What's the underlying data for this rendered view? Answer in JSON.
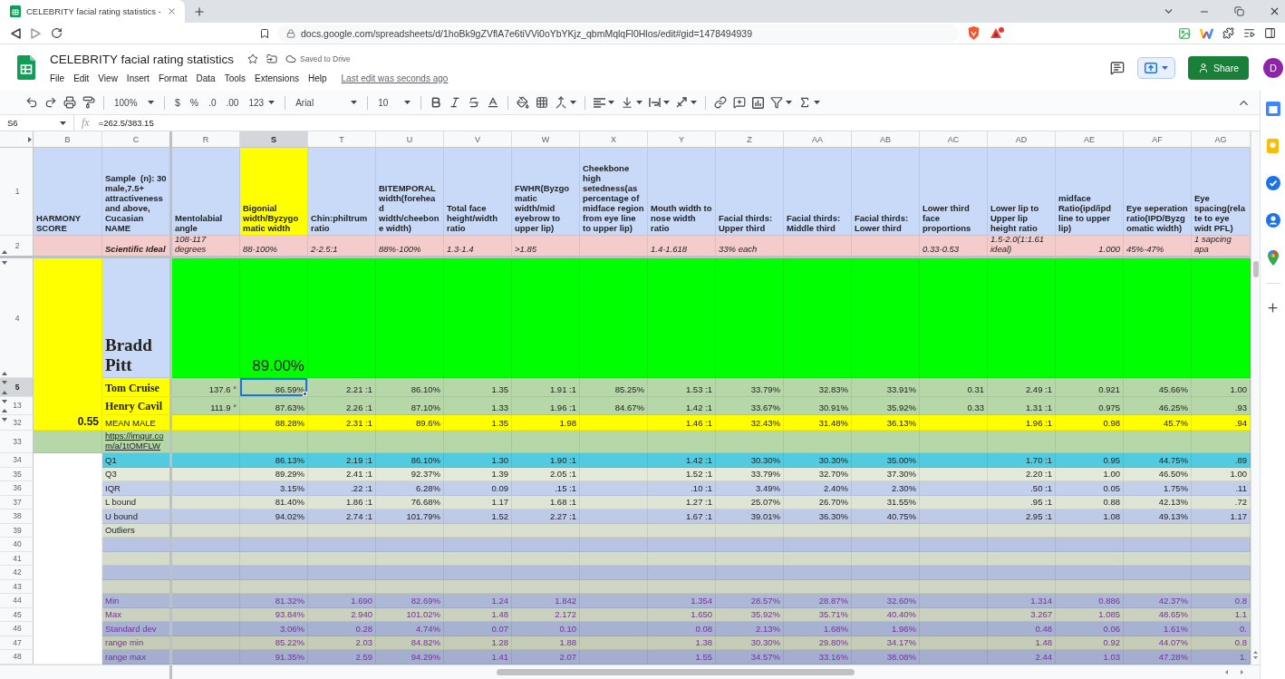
{
  "browser": {
    "tab_title": "CELEBRITY facial rating statistics -",
    "url": "docs.google.com/spreadsheets/d/1hoBk9gZVflA7e6tiVVi0oYbYKjz_qbmMqlqFl0Hlos/edit#gid=1478494939"
  },
  "document": {
    "title": "CELEBRITY facial rating statistics",
    "save_status": "Saved to Drive",
    "menu": [
      "File",
      "Edit",
      "View",
      "Insert",
      "Format",
      "Data",
      "Tools",
      "Extensions",
      "Help"
    ],
    "last_edit": "Last edit was seconds ago",
    "share_button": "Share",
    "avatar": "D"
  },
  "toolbar": {
    "zoom": "100%",
    "currency": "$",
    "percent": "%",
    "decimal_decrease": ".0",
    "decimal_increase": ".00",
    "number_format": "123",
    "font": "Arial",
    "font_size": "10"
  },
  "formula_bar": {
    "cell": "S6",
    "label": "fx",
    "formula": "=262.5/383.15"
  },
  "sheet": {
    "columns": [
      {
        "letter": "B",
        "selected": false,
        "highlighted": false
      },
      {
        "letter": "C",
        "selected": false,
        "highlighted": false
      },
      {
        "letter": "R",
        "selected": false,
        "highlighted": false
      },
      {
        "letter": "S",
        "selected": true,
        "highlighted": true
      },
      {
        "letter": "T",
        "selected": false,
        "highlighted": false
      },
      {
        "letter": "U",
        "selected": false,
        "highlighted": false
      },
      {
        "letter": "V",
        "selected": false,
        "highlighted": false
      },
      {
        "letter": "W",
        "selected": false,
        "highlighted": false
      },
      {
        "letter": "X",
        "selected": false,
        "highlighted": false
      },
      {
        "letter": "Y",
        "selected": false,
        "highlighted": false
      },
      {
        "letter": "Z",
        "selected": false,
        "highlighted": false
      },
      {
        "letter": "AA",
        "selected": false,
        "highlighted": false
      },
      {
        "letter": "AB",
        "selected": false,
        "highlighted": false
      },
      {
        "letter": "AC",
        "selected": false,
        "highlighted": false
      },
      {
        "letter": "AD",
        "selected": false,
        "highlighted": false
      },
      {
        "letter": "AE",
        "selected": false,
        "highlighted": false
      },
      {
        "letter": "AF",
        "selected": false,
        "highlighted": false
      },
      {
        "letter": "AG",
        "selected": false,
        "highlighted": false
      }
    ],
    "rows": [
      {
        "number": "1",
        "kind": "header",
        "selected": false,
        "hidden_above": false,
        "hidden_below": false,
        "cells": [
          "HARMONY SCORE",
          "Sample  (n): 30 male,7.5+ attractiveness and above, Cucasian NAME",
          "Mentolabial angle",
          "Bigonial width/Byzygomatic width",
          "Chin:philtrum ratio",
          "BITEMPORAL width(forehead width/cheebone width)",
          "Total face height/width ratio",
          "FWHR(Byzgomatic width/mid eyebrow to upper lip)",
          "Cheekbone high setedness(as percentage of midface region from eye line to upper lip)",
          "Mouth width to nose width ratio",
          "Facial thirds: Upper third",
          "Facial thirds: Middle third",
          "Facial thirds: Lower third",
          "Lower third face proportions",
          "Lower lip to Upper lip height ratio",
          "midface Ratio(ipd/ipd line to upper lip)",
          "Eye seperation ratio(IPD/Byzgomatic width)",
          "Eye spacing(relate to eye widt PFL)"
        ]
      },
      {
        "number": "2",
        "kind": "ideal",
        "selected": false,
        "hidden_above": false,
        "hidden_below": true,
        "cells": [
          null,
          "Scientific Ideal",
          "108-117 degrees",
          "88-100%",
          "2-2.5:1",
          "88%-100%",
          "1.3-1.4",
          ">1.85",
          null,
          "1.4-1.618",
          "33% each",
          null,
          null,
          "0.33-0.53",
          "1.5-2.0(1:1.61 ideal)",
          {
            "text": "1.000",
            "kind": "number"
          },
          "45%-47%",
          "1 sapcing apa"
        ]
      },
      {
        "number": "4",
        "kind": "photo",
        "selected": false,
        "hidden_above": true,
        "hidden_below": true,
        "cells": [
          null,
          "Bradd Pitt",
          null,
          "89.00%"
        ]
      },
      {
        "number": "5",
        "kind": "person",
        "selected": true,
        "hidden_above": true,
        "hidden_below": true,
        "cells": [
          null,
          "Tom Cruise",
          "137.6 °",
          "86.59%",
          "2.21 :1",
          "86.10%",
          "1.35",
          "1.91 :1",
          "85.25%",
          "1.53 :1",
          "33.79%",
          "32.83%",
          "33.91%",
          "0.31",
          "2.49 :1",
          "0.921",
          "45.66%",
          "1.00"
        ]
      },
      {
        "number": "13",
        "kind": "person",
        "selected": false,
        "hidden_above": true,
        "hidden_below": true,
        "cells": [
          null,
          "Henry Cavil",
          "111.9 °",
          "87.63%",
          "2.26 :1",
          "87.10%",
          "1.33",
          "1.96 :1",
          "84.67%",
          "1.42 :1",
          "33.67%",
          "30.91%",
          "35.92%",
          "0.33",
          "1.31 :1",
          "0.975",
          "46.25%",
          ".93"
        ]
      },
      {
        "number": "32",
        "kind": "mean",
        "selected": false,
        "hidden_above": true,
        "hidden_below": false,
        "cells": [
          "0.55",
          "MEAN MALE",
          null,
          "88.28%",
          "2.31 :1",
          "89.6%",
          "1.35",
          "1.98",
          null,
          "1.46 :1",
          "32.43%",
          "31.48%",
          "36.13%",
          null,
          "1.96 :1",
          "0.98",
          "45.7%",
          ".94"
        ]
      },
      {
        "number": "33",
        "kind": "link",
        "selected": false,
        "hidden_above": false,
        "hidden_below": false,
        "cells": [
          null,
          "https://imgur.com/a/1tOMFLW"
        ]
      },
      {
        "number": "34",
        "kind": "highlight",
        "selected": false,
        "hidden_above": false,
        "hidden_below": false,
        "cells": [
          null,
          "Q1",
          null,
          "86.13%",
          "2.19 :1",
          "86.10%",
          "1.30",
          "1.90 :1",
          null,
          "1.42 :1",
          "30.30%",
          "30.30%",
          "35.00%",
          null,
          "1.70 :1",
          "0.95",
          "44.75%",
          ".89"
        ]
      },
      {
        "number": "35",
        "kind": "stat",
        "selected": false,
        "hidden_above": false,
        "hidden_below": false,
        "cells": [
          null,
          "Q3",
          null,
          "89.29%",
          "2.41 :1",
          "92.37%",
          "1.39",
          "2.05 :1",
          null,
          "1.52 :1",
          "33.79%",
          "32.70%",
          "37.30%",
          null,
          "2.20 :1",
          "1.00",
          "46.50%",
          "1.00"
        ]
      },
      {
        "number": "36",
        "kind": "stat",
        "selected": false,
        "hidden_above": false,
        "hidden_below": false,
        "cells": [
          null,
          "IQR",
          null,
          "3.15%",
          ".22 :1",
          "6.28%",
          "0.09",
          ".15 :1",
          null,
          ".10 :1",
          "3.49%",
          "2.40%",
          "2.30%",
          null,
          ".50 :1",
          "0.05",
          "1.75%",
          ".11"
        ]
      },
      {
        "number": "37",
        "kind": "stat",
        "selected": false,
        "hidden_above": false,
        "hidden_below": false,
        "cells": [
          null,
          "L bound",
          null,
          "81.40%",
          "1.86 :1",
          "76.68%",
          "1.17",
          "1.68 :1",
          null,
          "1.27 :1",
          "25.07%",
          "26.70%",
          "31.55%",
          null,
          ".95 :1",
          "0.88",
          "42.13%",
          ".72"
        ]
      },
      {
        "number": "38",
        "kind": "stat",
        "selected": false,
        "hidden_above": false,
        "hidden_below": false,
        "cells": [
          null,
          "U bound",
          null,
          "94.02%",
          "2.74 :1",
          "101.79%",
          "1.52",
          "2.27 :1",
          null,
          "1.67 :1",
          "39.01%",
          "36.30%",
          "40.75%",
          null,
          "2.95 :1",
          "1.08",
          "49.13%",
          "1.17"
        ]
      },
      {
        "number": "39",
        "kind": "stat",
        "selected": false,
        "hidden_above": false,
        "hidden_below": false,
        "cells": [
          null,
          "Outliers"
        ]
      },
      {
        "number": "40",
        "kind": "stat",
        "selected": false,
        "hidden_above": false,
        "hidden_below": false
      },
      {
        "number": "41",
        "kind": "stat",
        "selected": false,
        "hidden_above": false,
        "hidden_below": false
      },
      {
        "number": "42",
        "kind": "stat",
        "selected": false,
        "hidden_above": false,
        "hidden_below": false
      },
      {
        "number": "43",
        "kind": "stat",
        "selected": false,
        "hidden_above": false,
        "hidden_below": false
      },
      {
        "number": "44",
        "kind": "summary",
        "selected": false,
        "hidden_above": false,
        "hidden_below": false,
        "cells": [
          null,
          "Min",
          null,
          "81.32%",
          "1.690",
          "82.69%",
          "1.24",
          "1.842",
          null,
          "1.354",
          "28.57%",
          "28.87%",
          "32.60%",
          null,
          "1.314",
          "0.886",
          "42.37%",
          "0.8"
        ]
      },
      {
        "number": "45",
        "kind": "summary",
        "selected": false,
        "hidden_above": false,
        "hidden_below": false,
        "cells": [
          null,
          "Max",
          null,
          "93.84%",
          "2.940",
          "101.02%",
          "1.48",
          "2.172",
          null,
          "1.650",
          "35.92%",
          "35.71%",
          "40.40%",
          null,
          "3.267",
          "1.085",
          "48.65%",
          "1.1"
        ]
      },
      {
        "number": "46",
        "kind": "summary",
        "selected": false,
        "hidden_above": false,
        "hidden_below": false,
        "cells": [
          null,
          "Standard dev",
          null,
          "3.06%",
          "0.28",
          "4.74%",
          "0.07",
          "0.10",
          null,
          "0.08",
          "2.13%",
          "1.68%",
          "1.96%",
          null,
          "0.48",
          "0.06",
          "1.61%",
          "0."
        ]
      },
      {
        "number": "47",
        "kind": "summary",
        "selected": false,
        "hidden_above": false,
        "hidden_below": false,
        "cells": [
          null,
          "range min",
          null,
          "85.22%",
          "2.03",
          "84.82%",
          "1.28",
          "1.88",
          null,
          "1.38",
          "30.30%",
          "29.80%",
          "34.17%",
          null,
          "1.48",
          "0.92",
          "44.07%",
          "0.8"
        ]
      },
      {
        "number": "48",
        "kind": "summary",
        "selected": false,
        "hidden_above": false,
        "hidden_below": false,
        "cells": [
          null,
          "range max",
          null,
          "91.35%",
          "2.59",
          "94.29%",
          "1.41",
          "2.07",
          null,
          "1.55",
          "34.57%",
          "33.16%",
          "38.08%",
          null,
          "2.44",
          "1.03",
          "47.28%",
          "1."
        ]
      }
    ]
  }
}
